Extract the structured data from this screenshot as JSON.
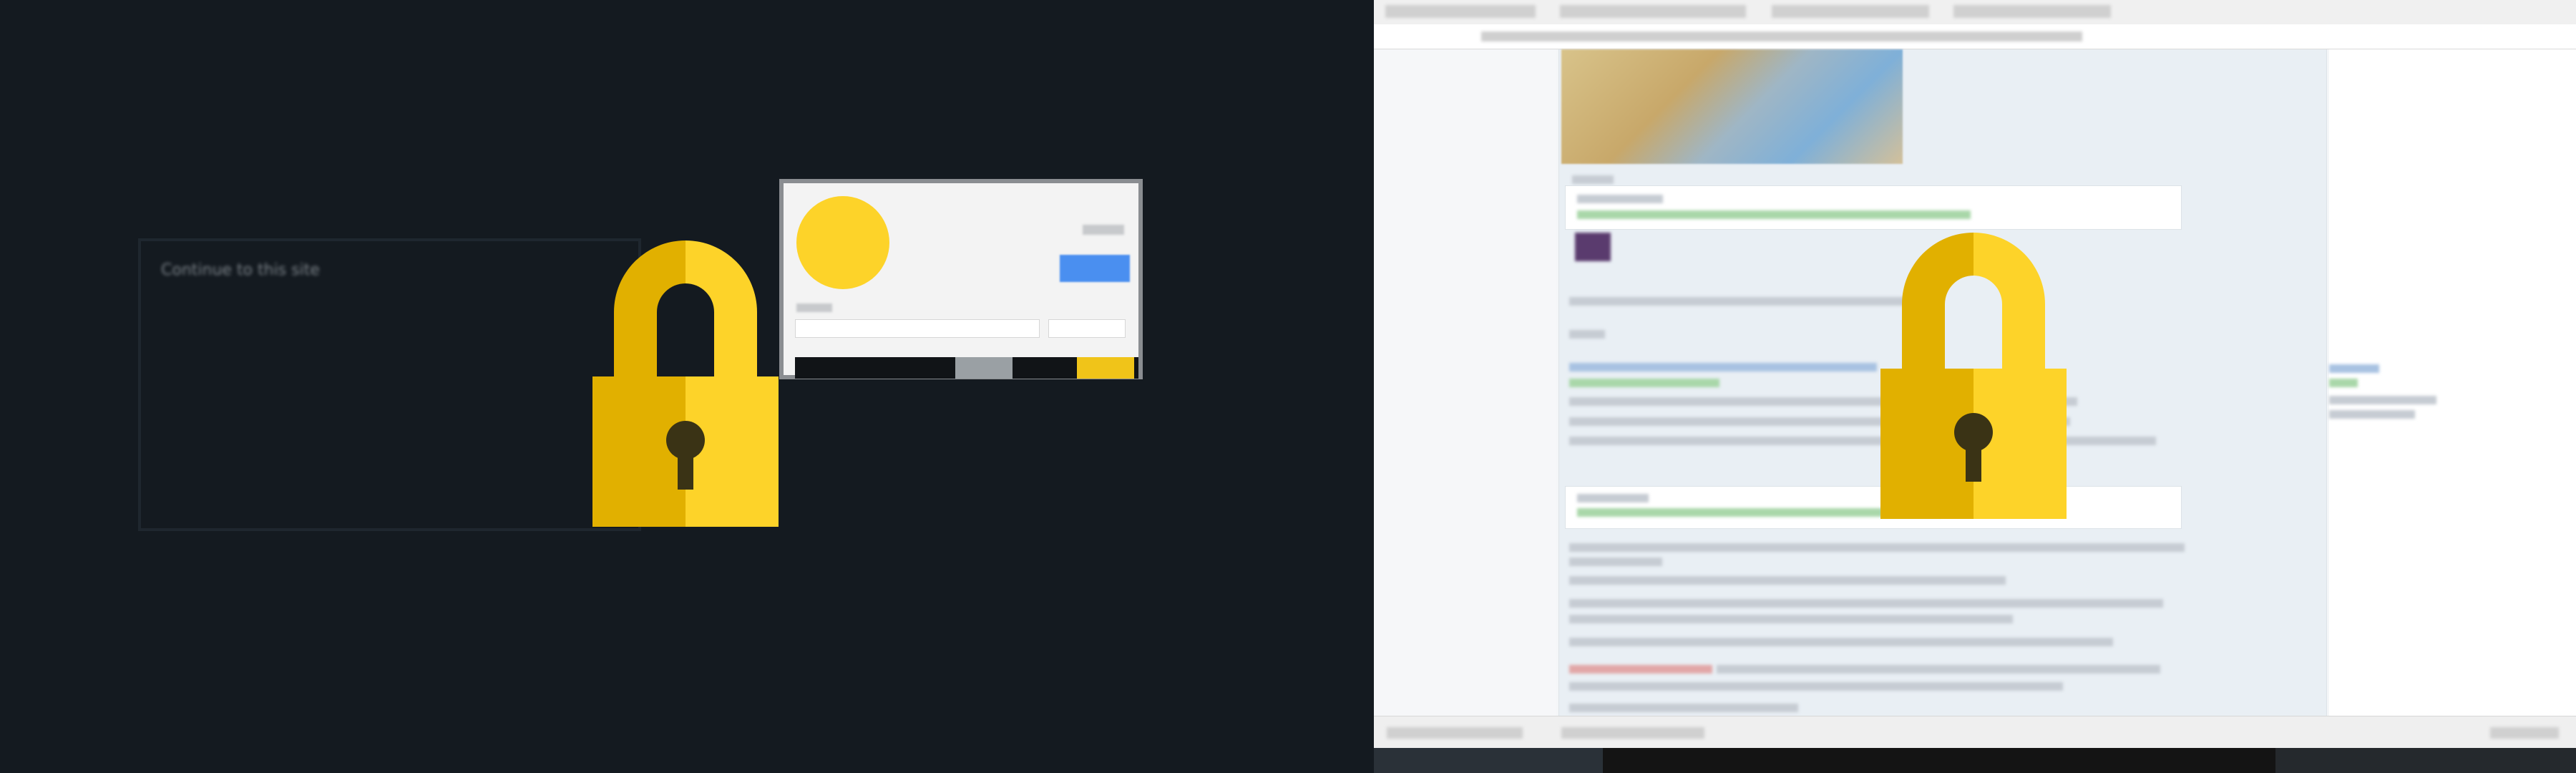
{
  "left_panel": {
    "dialog": {
      "title": "Continue to this site"
    },
    "thumbnail": {
      "avatar_color": "#fdd329",
      "button_color": "#4a8ff0"
    }
  },
  "right_panel": {
    "colors": {
      "lock_left": "#e1b000",
      "lock_right": "#fdd329",
      "keyhole": "#3a3315"
    }
  }
}
